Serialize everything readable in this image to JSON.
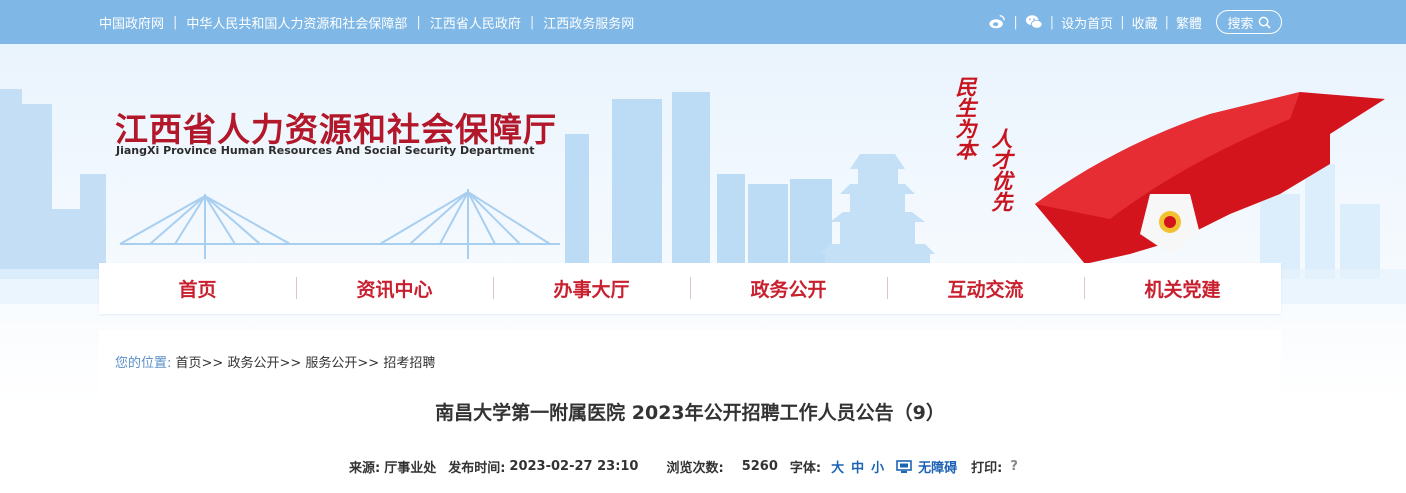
{
  "topbar": {
    "links": [
      "中国政府网",
      "中华人民共和国人力资源和社会保障部",
      "江西省人民政府",
      "江西政务服务网"
    ],
    "right": {
      "icons": [
        "weibo-icon",
        "wechat-icon"
      ],
      "set_home": "设为首页",
      "favorite": "收藏",
      "traditional": "繁體",
      "search": "搜索"
    }
  },
  "header": {
    "title_cn": "江西省人力资源和社会保障厅",
    "title_en": "JiangXi Province Human Resources And Social Security Department",
    "slogan_1": "民生为本",
    "slogan_2": "人才优先"
  },
  "nav": {
    "items": [
      "首页",
      "资讯中心",
      "办事大厅",
      "政务公开",
      "互动交流",
      "机关党建"
    ]
  },
  "breadcrumb": {
    "label": "您的位置:",
    "items": [
      "首页>>",
      "政务公开>>",
      "服务公开>>",
      "招考招聘"
    ]
  },
  "article": {
    "title": "南昌大学第一附属医院 2023年公开招聘工作人员公告（9）",
    "meta": {
      "source_label": "来源:",
      "source": "厅事业处",
      "date_label": "发布时间:",
      "date": "2023-02-27 23:10",
      "views_label": "浏览次数:",
      "views": "5260",
      "font_label": "字体:",
      "font_large": "大",
      "font_medium": "中",
      "font_small": "小",
      "accessible": "无障碍",
      "print_label": "打印:",
      "print_icon": "?"
    }
  },
  "colors": {
    "topbar": "#7fb7e6",
    "brand_red": "#b3172a",
    "nav_red": "#c8202f",
    "link_blue": "#1d63b5"
  }
}
